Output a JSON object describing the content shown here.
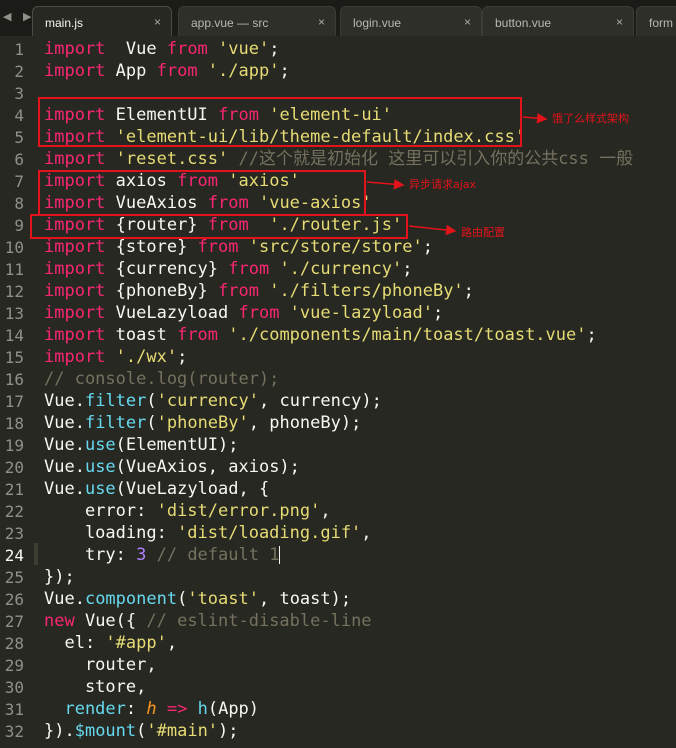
{
  "tabs": [
    {
      "label": "main.js",
      "close": "×",
      "active": true
    },
    {
      "label": "app.vue — src",
      "close": "×",
      "active": false
    },
    {
      "label": "login.vue",
      "close": "×",
      "active": false
    },
    {
      "label": "button.vue",
      "close": "×",
      "active": false
    },
    {
      "label": "form",
      "close": "",
      "active": false
    }
  ],
  "nav_arrows": "◀ ▶",
  "current_line": 24,
  "code_lines": [
    [
      [
        "kw",
        "import"
      ],
      [
        "",
        "  Vue "
      ],
      [
        "kw",
        "from"
      ],
      [
        "str",
        " 'vue'"
      ],
      [
        "",
        ";"
      ]
    ],
    [
      [
        "kw",
        "import"
      ],
      [
        "",
        " App "
      ],
      [
        "kw",
        "from"
      ],
      [
        "str",
        " './app'"
      ],
      [
        "",
        ";"
      ]
    ],
    [],
    [
      [
        "kw",
        "import"
      ],
      [
        "",
        " ElementUI "
      ],
      [
        "kw",
        "from"
      ],
      [
        "str",
        " 'element-ui'"
      ]
    ],
    [
      [
        "kw",
        "import"
      ],
      [
        "str",
        " 'element-ui/lib/theme-default/index.css'"
      ]
    ],
    [
      [
        "kw",
        "import"
      ],
      [
        "str",
        " 'reset.css'"
      ],
      [
        "cm",
        " //这个就是初始化 这里可以引入你的公共css 一般"
      ]
    ],
    [
      [
        "kw",
        "import"
      ],
      [
        "",
        " axios "
      ],
      [
        "kw",
        "from"
      ],
      [
        "str",
        " 'axios'"
      ]
    ],
    [
      [
        "kw",
        "import"
      ],
      [
        "",
        " VueAxios "
      ],
      [
        "kw",
        "from"
      ],
      [
        "str",
        " 'vue-axios'"
      ]
    ],
    [
      [
        "kw",
        "import"
      ],
      [
        "",
        " {router} "
      ],
      [
        "kw",
        "from"
      ],
      [
        "str",
        "  './router.js'"
      ]
    ],
    [
      [
        "kw",
        "import"
      ],
      [
        "",
        " {store} "
      ],
      [
        "kw",
        "from"
      ],
      [
        "str",
        " 'src/store/store'"
      ],
      [
        "",
        ";"
      ]
    ],
    [
      [
        "kw",
        "import"
      ],
      [
        "",
        " {currency} "
      ],
      [
        "kw",
        "from"
      ],
      [
        "str",
        " './currency'"
      ],
      [
        "",
        ";"
      ]
    ],
    [
      [
        "kw",
        "import"
      ],
      [
        "",
        " {phoneBy} "
      ],
      [
        "kw",
        "from"
      ],
      [
        "str",
        " './filters/phoneBy'"
      ],
      [
        "",
        ";"
      ]
    ],
    [
      [
        "kw",
        "import"
      ],
      [
        "",
        " VueLazyload "
      ],
      [
        "kw",
        "from"
      ],
      [
        "str",
        " 'vue-lazyload'"
      ],
      [
        "",
        ";"
      ]
    ],
    [
      [
        "kw",
        "import"
      ],
      [
        "",
        " toast "
      ],
      [
        "kw",
        "from"
      ],
      [
        "str",
        " './components/main/toast/toast.vue'"
      ],
      [
        "",
        ";"
      ]
    ],
    [
      [
        "kw",
        "import"
      ],
      [
        "str",
        " './wx'"
      ],
      [
        "",
        ";"
      ]
    ],
    [
      [
        "cm",
        "// console.log(router);"
      ]
    ],
    [
      [
        "",
        "Vue."
      ],
      [
        "fn",
        "filter"
      ],
      [
        "",
        "("
      ],
      [
        "str",
        "'currency'"
      ],
      [
        "",
        ", currency);"
      ]
    ],
    [
      [
        "",
        "Vue."
      ],
      [
        "fn",
        "filter"
      ],
      [
        "",
        "("
      ],
      [
        "str",
        "'phoneBy'"
      ],
      [
        "",
        ", phoneBy);"
      ]
    ],
    [
      [
        "",
        "Vue."
      ],
      [
        "fn",
        "use"
      ],
      [
        "",
        "(ElementUI);"
      ]
    ],
    [
      [
        "",
        "Vue."
      ],
      [
        "fn",
        "use"
      ],
      [
        "",
        "(VueAxios, axios);"
      ]
    ],
    [
      [
        "",
        "Vue."
      ],
      [
        "fn",
        "use"
      ],
      [
        "",
        "(VueLazyload, {"
      ]
    ],
    [
      [
        "",
        "    error: "
      ],
      [
        "str",
        "'dist/error.png'"
      ],
      [
        "",
        ","
      ]
    ],
    [
      [
        "",
        "    loading: "
      ],
      [
        "str",
        "'dist/loading.gif'"
      ],
      [
        "",
        ","
      ]
    ],
    [
      [
        "",
        "    try: "
      ],
      [
        "num",
        "3"
      ],
      [
        "cm",
        " // default 1"
      ]
    ],
    [
      [
        "",
        "});"
      ]
    ],
    [
      [
        "",
        "Vue."
      ],
      [
        "fn",
        "component"
      ],
      [
        "",
        "("
      ],
      [
        "str",
        "'toast'"
      ],
      [
        "",
        ", toast);"
      ]
    ],
    [
      [
        "kw",
        "new"
      ],
      [
        "",
        " Vue({ "
      ],
      [
        "cm",
        "// eslint-disable-line"
      ]
    ],
    [
      [
        "",
        "  el: "
      ],
      [
        "str",
        "'#app'"
      ],
      [
        "",
        ","
      ]
    ],
    [
      [
        "",
        "    router,"
      ]
    ],
    [
      [
        "",
        "    store,"
      ]
    ],
    [
      [
        "fn",
        "  render"
      ],
      [
        "",
        ": "
      ],
      [
        "par",
        "h"
      ],
      [
        "kw",
        " =>"
      ],
      [
        "",
        " "
      ],
      [
        "fn",
        "h"
      ],
      [
        "",
        "(App)"
      ]
    ],
    [
      [
        "",
        "})."
      ],
      [
        "fn",
        "$mount"
      ],
      [
        "",
        "("
      ],
      [
        "str",
        "'#main'"
      ],
      [
        "",
        ");"
      ]
    ]
  ],
  "annotations": [
    {
      "text": "饿了么样式架构"
    },
    {
      "text": "异步请求ajax"
    },
    {
      "text": "路由配置"
    }
  ],
  "colors": {
    "background": "#272822",
    "keyword": "#f92672",
    "string": "#e6db74",
    "comment": "#75715e",
    "function": "#66d9ef",
    "number": "#ae81ff",
    "annotation": "#e2131a"
  }
}
